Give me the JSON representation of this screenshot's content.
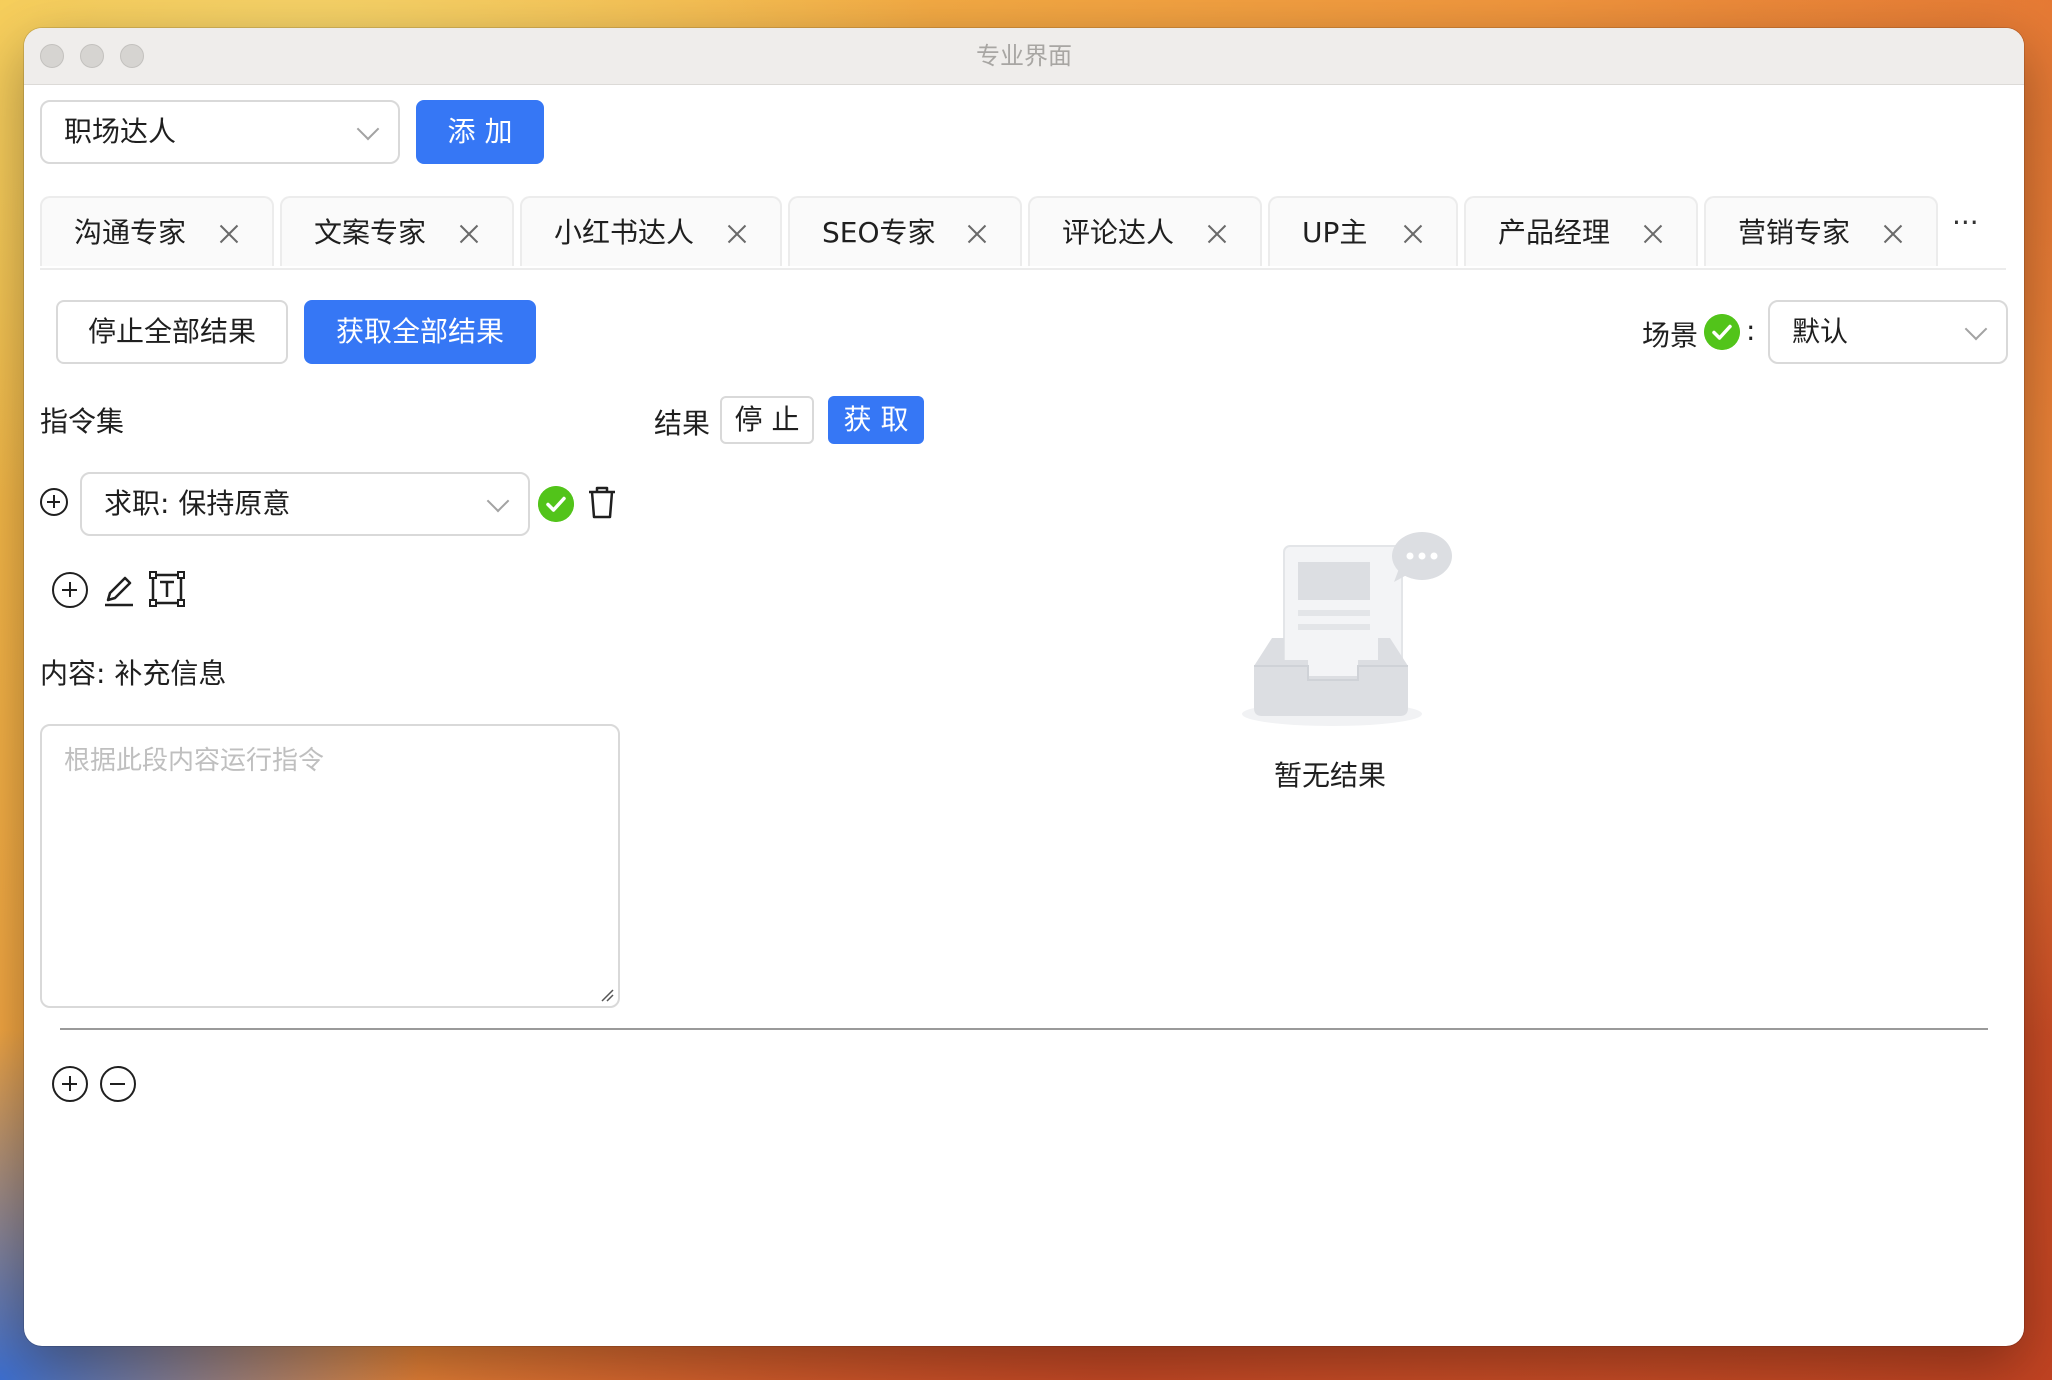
{
  "window": {
    "title": "专业界面"
  },
  "role_select": {
    "value": "职场达人"
  },
  "add_button": {
    "label": "添 加"
  },
  "tabs": [
    {
      "label": "沟通专家"
    },
    {
      "label": "文案专家"
    },
    {
      "label": "小红书达人"
    },
    {
      "label": "SEO专家"
    },
    {
      "label": "评论达人"
    },
    {
      "label": "UP主"
    },
    {
      "label": "产品经理"
    },
    {
      "label": "营销专家"
    }
  ],
  "tabs_more": "···",
  "toolbar": {
    "stop_all_label": "停止全部结果",
    "fetch_all_label": "获取全部结果",
    "scene_label": "场景",
    "scene_colon": ":",
    "scene_value": "默认"
  },
  "instructions": {
    "title": "指令集",
    "selected": "求职: 保持原意",
    "content_label": "内容: 补充信息",
    "placeholder": "根据此段内容运行指令"
  },
  "results": {
    "title": "结果",
    "stop_label": "停 止",
    "fetch_label": "获 取",
    "empty_text": "暂无结果"
  },
  "colors": {
    "primary": "#3677f5",
    "success": "#52c41a"
  }
}
